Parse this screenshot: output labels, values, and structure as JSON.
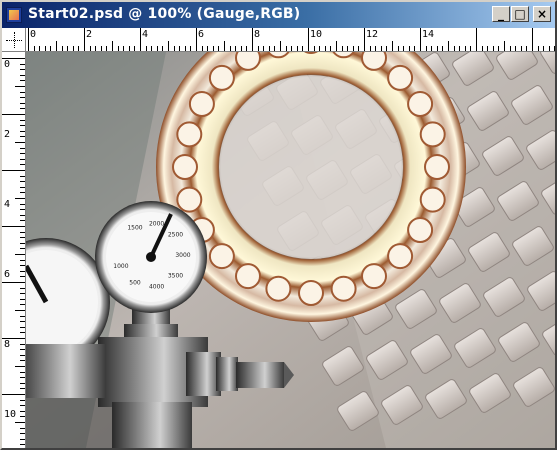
{
  "window": {
    "title": "Start02.psd @ 100% (Gauge,RGB)",
    "buttons": {
      "minimize": "_",
      "maximize": "□",
      "close": "×"
    }
  },
  "ruler": {
    "unit": "cm",
    "top_labels": [
      "0",
      "2",
      "4",
      "6",
      "8",
      "10",
      "12",
      "14"
    ],
    "left_labels": [
      "0",
      "2",
      "4",
      "6",
      "8",
      "10"
    ]
  },
  "document": {
    "name": "Start02.psd",
    "zoom": "100%",
    "active_layer": "Gauge",
    "color_mode": "RGB",
    "gauge_small_labels": [
      "1500",
      "2000",
      "2500",
      "3000",
      "3500",
      "4000",
      "500",
      "1000"
    ]
  },
  "colors": {
    "titlebar_start": "#0a246a",
    "titlebar_end": "#a6caf0",
    "chrome": "#d4d0c8"
  }
}
